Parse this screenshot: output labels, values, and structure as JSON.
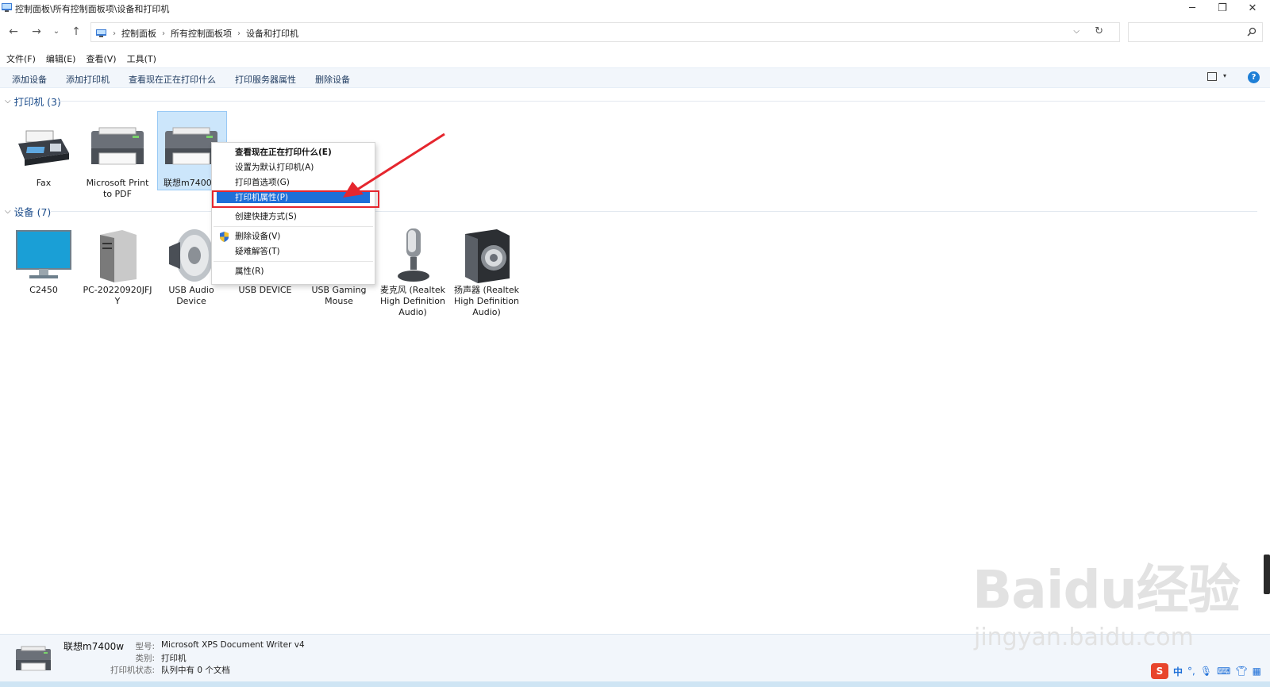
{
  "window": {
    "title": "控制面板\\所有控制面板项\\设备和打印机",
    "minimize": "─",
    "restore": "❐",
    "close": "✕"
  },
  "nav": {
    "back": "←",
    "forward": "→",
    "recent": "⌄",
    "up": "↑"
  },
  "address": {
    "crumbs": [
      "控制面板",
      "所有控制面板项",
      "设备和打印机"
    ],
    "separator": "›",
    "dropdown": "⌵",
    "refresh": "↻"
  },
  "search": {
    "placeholder": ""
  },
  "menu": [
    "文件(F)",
    "编辑(E)",
    "查看(V)",
    "工具(T)"
  ],
  "toolbar": {
    "items": [
      "添加设备",
      "添加打印机",
      "查看现在正在打印什么",
      "打印服务器属性",
      "删除设备"
    ],
    "view_dropdown": "▾",
    "help": "?"
  },
  "groups": {
    "printers": "打印机 (3)",
    "devices": "设备 (7)"
  },
  "printers": [
    {
      "label": "Fax"
    },
    {
      "label": "Microsoft Print to PDF"
    },
    {
      "label": "联想m7400w"
    }
  ],
  "devices": [
    {
      "label": "C2450"
    },
    {
      "label": "PC-20220920JFJY"
    },
    {
      "label": "USB Audio Device"
    },
    {
      "label": "USB DEVICE"
    },
    {
      "label": "USB Gaming Mouse"
    },
    {
      "label": "麦克风 (Realtek High Definition Audio)"
    },
    {
      "label": "扬声器 (Realtek High Definition Audio)"
    }
  ],
  "context_menu": {
    "see_printing": "查看现在正在打印什么(E)",
    "set_default": "设置为默认打印机(A)",
    "printing_prefs": "打印首选项(G)",
    "printer_props": "打印机属性(P)",
    "create_shortcut": "创建快捷方式(S)",
    "remove_device": "删除设备(V)",
    "troubleshoot": "疑难解答(T)",
    "properties": "属性(R)"
  },
  "details": {
    "name": "联想m7400w",
    "model_key": "型号:",
    "model_val": "Microsoft XPS Document Writer v4",
    "cat_key": "类别:",
    "cat_val": "打印机",
    "status_key": "打印机状态:",
    "status_val": "队列中有 0 个文档"
  },
  "watermark": {
    "brand": "Baidu经验",
    "url": "jingyan.baidu.com"
  },
  "ime": {
    "logo": "S",
    "lang": "中",
    "punct": "°,"
  },
  "colors": {
    "accent": "#1e6fd8",
    "highlight_box": "#e5262e",
    "selection": "#cce6fb"
  }
}
